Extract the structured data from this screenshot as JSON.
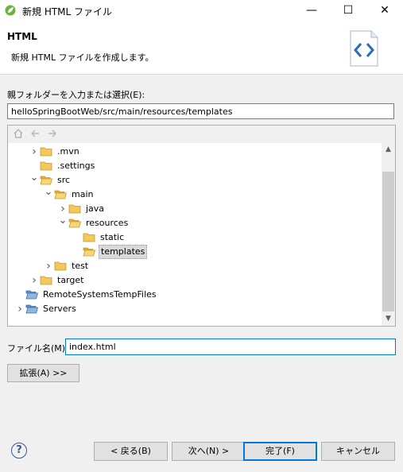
{
  "window": {
    "title": "新規 HTML ファイル",
    "minimize": "—",
    "maximize": "☐",
    "close": "✕"
  },
  "banner": {
    "title": "HTML",
    "description": "新規 HTML ファイルを作成します。",
    "icon": "html-code-icon"
  },
  "folder": {
    "label": "親フォルダーを入力または選択(E):",
    "value": "helloSpringBootWeb/src/main/resources/templates"
  },
  "tree_toolbar": {
    "home": "home-icon",
    "back": "back-arrow-icon",
    "forward": "forward-arrow-icon"
  },
  "tree": [
    {
      "label": ".mvn",
      "depth": 1,
      "twisty": "collapsed",
      "icon": "folder-icon"
    },
    {
      "label": ".settings",
      "depth": 1,
      "twisty": "none",
      "icon": "folder-icon"
    },
    {
      "label": "src",
      "depth": 1,
      "twisty": "expanded",
      "icon": "folder-open-icon"
    },
    {
      "label": "main",
      "depth": 2,
      "twisty": "expanded",
      "icon": "folder-open-icon"
    },
    {
      "label": "java",
      "depth": 3,
      "twisty": "collapsed",
      "icon": "folder-icon"
    },
    {
      "label": "resources",
      "depth": 3,
      "twisty": "expanded",
      "icon": "folder-open-icon"
    },
    {
      "label": "static",
      "depth": 4,
      "twisty": "none",
      "icon": "folder-icon"
    },
    {
      "label": "templates",
      "depth": 4,
      "twisty": "none",
      "icon": "folder-open-icon",
      "selected": true
    },
    {
      "label": "test",
      "depth": 2,
      "twisty": "collapsed",
      "icon": "folder-icon"
    },
    {
      "label": "target",
      "depth": 1,
      "twisty": "collapsed",
      "icon": "folder-icon"
    },
    {
      "label": "RemoteSystemsTempFiles",
      "depth": 0,
      "twisty": "none",
      "icon": "project-folder-icon"
    },
    {
      "label": "Servers",
      "depth": 0,
      "twisty": "collapsed",
      "icon": "project-folder-icon"
    }
  ],
  "filename": {
    "label": "ファイル名(M):",
    "value": "index.html"
  },
  "advanced_button": "拡張(A) >>",
  "footer": {
    "help": "?",
    "back": "< 戻る(B)",
    "next": "次へ(N) >",
    "finish": "完了(F)",
    "cancel": "キャンセル"
  },
  "colors": {
    "accent": "#0078d7",
    "folder": "#e8b84a",
    "selection": "#d9d9d9"
  }
}
